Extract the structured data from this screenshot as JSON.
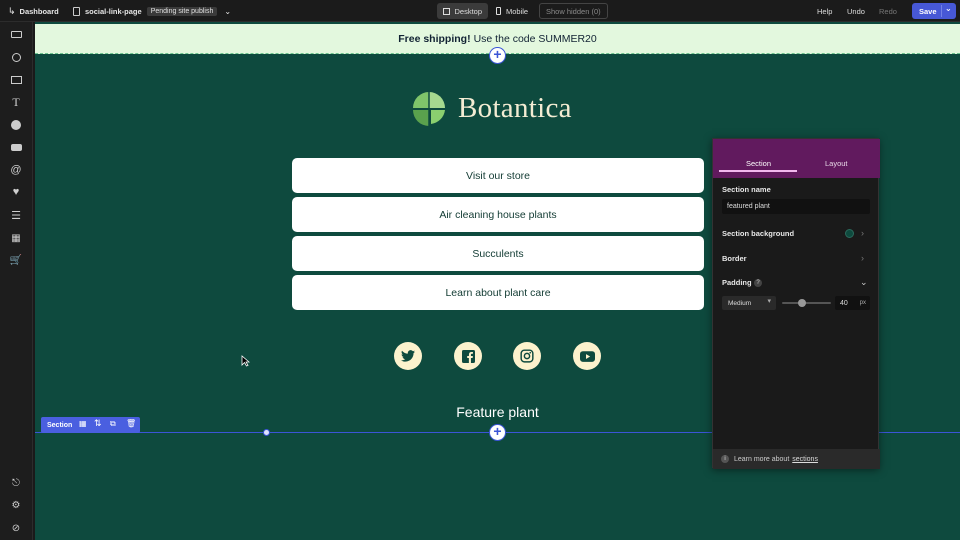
{
  "topbar": {
    "dashboard_label": "Dashboard",
    "page_name": "social-link-page",
    "publish_status": "Pending site publish",
    "desktop_label": "Desktop",
    "mobile_label": "Mobile",
    "show_hidden_label": "Show hidden (0)",
    "help_label": "Help",
    "undo_label": "Undo",
    "redo_label": "Redo",
    "save_label": "Save"
  },
  "banner": {
    "bold_text": "Free shipping!",
    "text": "Use the code SUMMER20"
  },
  "brand": {
    "name": "Botantica"
  },
  "links": [
    {
      "label": "Visit our store"
    },
    {
      "label": "Air cleaning house plants"
    },
    {
      "label": "Succulents"
    },
    {
      "label": "Learn about plant care"
    }
  ],
  "social_icons": [
    "twitter-icon",
    "facebook-icon",
    "instagram-icon",
    "youtube-icon"
  ],
  "feature": {
    "title": "Feature plant"
  },
  "section_toolbar": {
    "label": "Section"
  },
  "panel": {
    "tab_section": "Section",
    "tab_layout": "Layout",
    "section_name_label": "Section name",
    "section_name_value": "featured plant",
    "background_label": "Section background",
    "border_label": "Border",
    "padding_label": "Padding",
    "padding_help": "?",
    "padding_preset": "Medium",
    "padding_value": "40",
    "padding_unit": "px",
    "padding_slider_fraction": 0.4,
    "footer_text": "Learn more about",
    "footer_link": "sections"
  },
  "colors": {
    "canvas_bg": "#0e4a3e",
    "banner_bg": "#e3f8de",
    "accent": "#4758d6",
    "panel_header": "#611a5e",
    "social_bg": "#fcf2cd"
  }
}
